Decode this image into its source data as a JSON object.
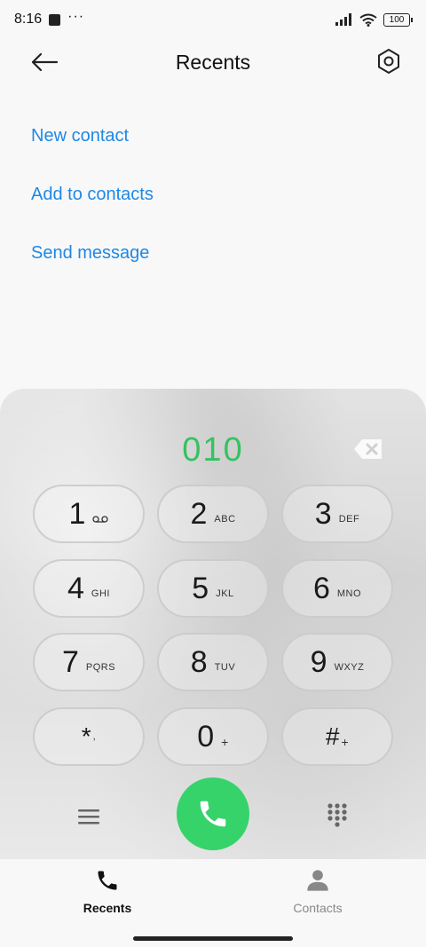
{
  "status_bar": {
    "time": "8:16",
    "dots": "···",
    "battery": "100"
  },
  "header": {
    "title": "Recents"
  },
  "actions": [
    "New contact",
    "Add to contacts",
    "Send message"
  ],
  "dialer": {
    "dialed_number": "010",
    "keys": [
      {
        "digit": "1",
        "sub": ""
      },
      {
        "digit": "2",
        "sub": "ABC"
      },
      {
        "digit": "3",
        "sub": "DEF"
      },
      {
        "digit": "4",
        "sub": "GHI"
      },
      {
        "digit": "5",
        "sub": "JKL"
      },
      {
        "digit": "6",
        "sub": "MNO"
      },
      {
        "digit": "7",
        "sub": "PQRS"
      },
      {
        "digit": "8",
        "sub": "TUV"
      },
      {
        "digit": "9",
        "sub": "WXYZ"
      },
      {
        "digit": "*",
        "sub": ","
      },
      {
        "digit": "0",
        "sub": "+"
      },
      {
        "digit": "#",
        "sub": "+"
      }
    ]
  },
  "bottom_nav": {
    "recents_label": "Recents",
    "contacts_label": "Contacts"
  },
  "colors": {
    "link": "#1f88e5",
    "dialed": "#35c260",
    "call": "#35d36a"
  }
}
